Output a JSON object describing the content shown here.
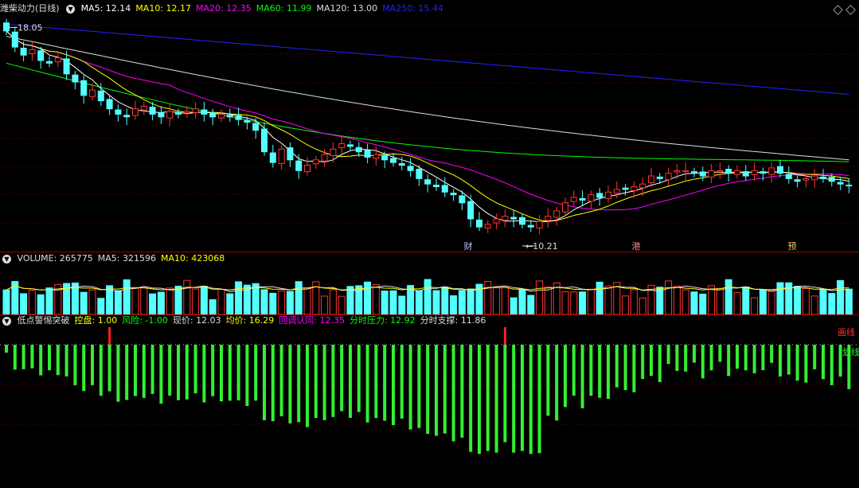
{
  "header": {
    "stock": "潍柴动力(日线)",
    "ma": [
      {
        "label": "MA5: 12.14",
        "color": "#ffffff"
      },
      {
        "label": "MA10: 12.17",
        "color": "#ffff00"
      },
      {
        "label": "MA20: 12.35",
        "color": "#ff00ff"
      },
      {
        "label": "MA60: 11.99",
        "color": "#00ff00"
      },
      {
        "label": "MA120: 13.00",
        "color": "#dddddd"
      },
      {
        "label": "MA250: 15.44",
        "color": "#2222ff"
      }
    ]
  },
  "volume_header": [
    {
      "label": "VOLUME: 265775",
      "color": "#dddddd"
    },
    {
      "label": "MA5: 321596",
      "color": "#dddddd"
    },
    {
      "label": "MA10: 423068",
      "color": "#ffff00"
    }
  ],
  "indicator_header": [
    {
      "label": "低点警惕突破",
      "color": "#dddddd"
    },
    {
      "label": "控盘: 1.00",
      "color": "#ffff00"
    },
    {
      "label": "风险: -1.00",
      "color": "#00ff00"
    },
    {
      "label": "现价: 12.03",
      "color": "#dddddd"
    },
    {
      "label": "均价: 16.29",
      "color": "#ffff00"
    },
    {
      "label": "回调认同: 12.35",
      "color": "#ff00ff"
    },
    {
      "label": "分时压力: 12.92",
      "color": "#00ff00"
    },
    {
      "label": "分时支撑: 11.86",
      "color": "#dddddd"
    }
  ],
  "annotations": {
    "high": "18.05",
    "low": "10.21",
    "marks": [
      "财",
      "港",
      "预"
    ]
  },
  "side_labels": [
    "画线",
    "划线"
  ],
  "colors": {
    "up": "#ff3232",
    "down": "#54ffff",
    "green_bar": "#33ee33"
  },
  "chart_data": [
    {
      "type": "candlestick",
      "ma_values": {
        "MA5": 12.14,
        "MA10": 12.17,
        "MA20": 12.35,
        "MA60": 11.99,
        "MA120": 13.0,
        "MA250": 15.44
      },
      "high": 18.05,
      "low": 10.21,
      "last_close": 12.03,
      "closes": [
        17.8,
        17.2,
        16.9,
        17.1,
        16.7,
        16.6,
        16.8,
        16.2,
        15.9,
        15.4,
        15.6,
        15.2,
        14.9,
        14.7,
        14.6,
        14.9,
        15.0,
        14.7,
        14.6,
        14.8,
        14.7,
        14.8,
        14.9,
        14.7,
        14.6,
        14.7,
        14.6,
        14.5,
        14.4,
        14.1,
        13.3,
        12.9,
        13.4,
        13.0,
        12.6,
        12.8,
        13.0,
        13.2,
        13.4,
        13.6,
        13.5,
        13.3,
        13.1,
        13.2,
        13.0,
        12.9,
        12.8,
        12.6,
        12.3,
        12.1,
        12.0,
        11.8,
        11.7,
        11.4,
        10.8,
        10.5,
        10.6,
        10.8,
        10.9,
        10.8,
        10.6,
        10.5,
        10.7,
        10.9,
        11.1,
        11.4,
        11.6,
        11.5,
        11.7,
        11.6,
        11.8,
        11.9,
        11.9,
        12.0,
        12.1,
        12.4,
        12.3,
        12.5,
        12.6,
        12.6,
        12.5,
        12.4,
        12.6,
        12.6,
        12.5,
        12.6,
        12.4,
        12.6,
        12.5,
        12.7,
        12.5,
        12.3,
        12.2,
        12.3,
        12.4,
        12.3,
        12.2,
        12.1,
        12.03
      ]
    },
    {
      "type": "bar",
      "name": "VOLUME",
      "values": [
        265775
      ],
      "ma": {
        "MA5": 321596,
        "MA10": 423068
      }
    },
    {
      "type": "bar",
      "name": "低点警惕突破",
      "values": {
        "控盘": 1.0,
        "风险": -1.0,
        "现价": 12.03,
        "均价": 16.29,
        "回调认同": 12.35,
        "分时压力": 12.92,
        "分时支撑": 11.86
      }
    }
  ]
}
